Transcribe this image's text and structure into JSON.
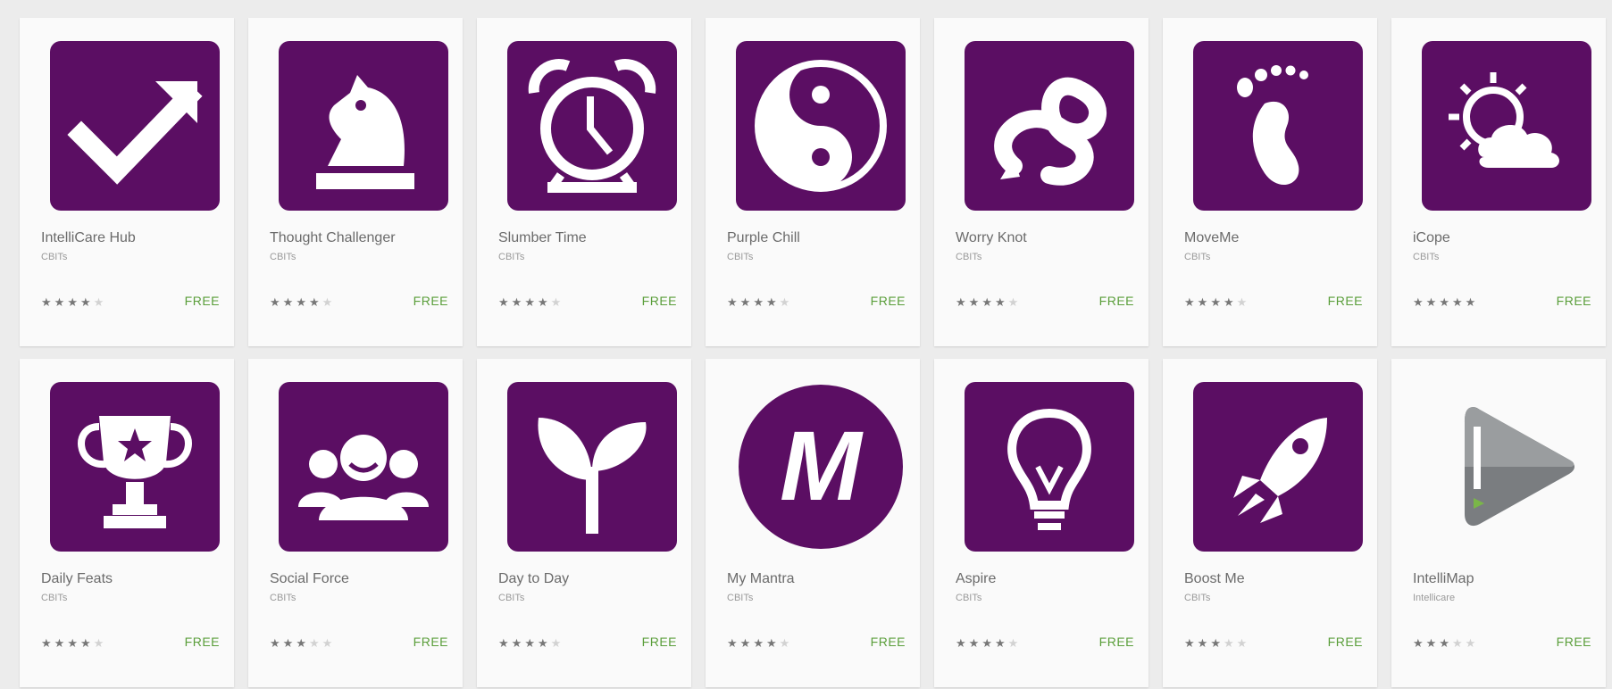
{
  "brand_color": "#5b0e63",
  "price_color": "#5a9e3a",
  "apps": [
    {
      "title": "IntelliCare Hub",
      "developer": "CBITs",
      "rating": 4,
      "price": "FREE",
      "icon": "check-arrow-icon",
      "fade": false
    },
    {
      "title": "Thought Challenger",
      "developer": "CBITs",
      "rating": 4,
      "price": "FREE",
      "icon": "chess-knight-icon",
      "fade": true
    },
    {
      "title": "Slumber Time",
      "developer": "CBITs",
      "rating": 4,
      "price": "FREE",
      "icon": "alarm-clock-icon",
      "fade": false
    },
    {
      "title": "Purple Chill",
      "developer": "CBITs",
      "rating": 4,
      "price": "FREE",
      "icon": "yin-yang-icon",
      "fade": false
    },
    {
      "title": "Worry Knot",
      "developer": "CBITs",
      "rating": 4,
      "price": "FREE",
      "icon": "knot-icon",
      "fade": false
    },
    {
      "title": "MoveMe",
      "developer": "CBITs",
      "rating": 4,
      "price": "FREE",
      "icon": "footprint-icon",
      "fade": false
    },
    {
      "title": "iCope",
      "developer": "CBITs",
      "rating": 5,
      "price": "FREE",
      "icon": "sun-cloud-icon",
      "fade": false
    },
    {
      "title": "Daily Feats",
      "developer": "CBITs",
      "rating": 4,
      "price": "FREE",
      "icon": "trophy-icon",
      "fade": false
    },
    {
      "title": "Social Force",
      "developer": "CBITs",
      "rating": 3,
      "price": "FREE",
      "icon": "group-people-icon",
      "fade": false
    },
    {
      "title": "Day to Day",
      "developer": "CBITs",
      "rating": 4,
      "price": "FREE",
      "icon": "sprout-icon",
      "fade": false
    },
    {
      "title": "My Mantra",
      "developer": "CBITs",
      "rating": 4,
      "price": "FREE",
      "icon": "m-letter-icon",
      "fade": false
    },
    {
      "title": "Aspire",
      "developer": "CBITs",
      "rating": 4,
      "price": "FREE",
      "icon": "light-bulb-icon",
      "fade": false
    },
    {
      "title": "Boost Me",
      "developer": "CBITs",
      "rating": 3,
      "price": "FREE",
      "icon": "rocket-icon",
      "fade": false
    },
    {
      "title": "IntelliMap",
      "developer": "Intellicare",
      "rating": 3,
      "price": "FREE",
      "icon": "play-triangle-icon",
      "fade": false
    }
  ]
}
